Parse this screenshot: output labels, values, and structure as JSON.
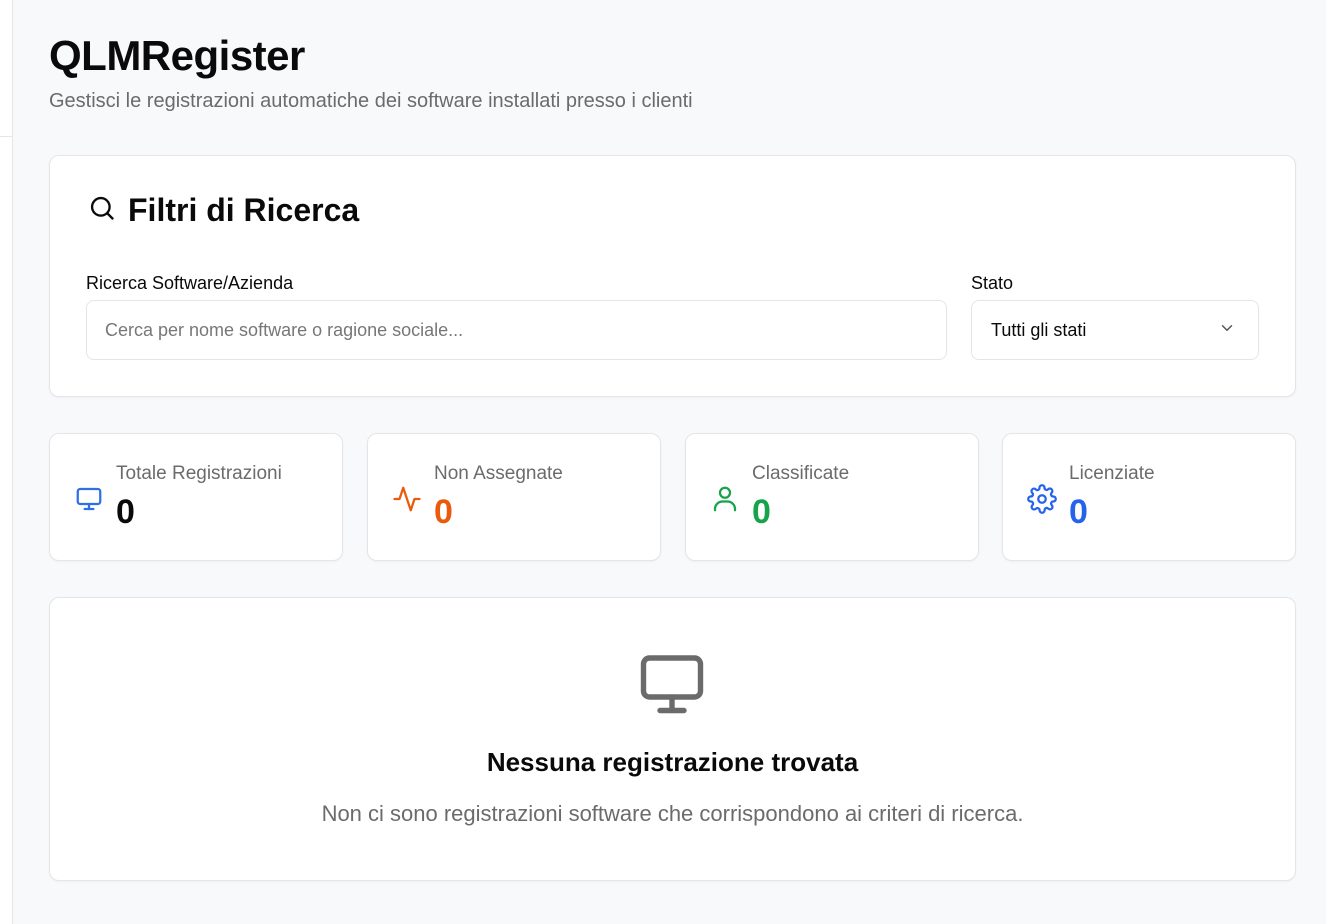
{
  "header": {
    "title": "QLMRegister",
    "subtitle": "Gestisci le registrazioni automatiche dei software installati presso i clienti"
  },
  "filters": {
    "title": "Filtri di Ricerca",
    "search": {
      "label": "Ricerca Software/Azienda",
      "placeholder": "Cerca per nome software o ragione sociale...",
      "value": ""
    },
    "status": {
      "label": "Stato",
      "selected": "Tutti gli stati"
    }
  },
  "stats": [
    {
      "label": "Totale Registrazioni",
      "value": "0",
      "icon": "monitor-icon",
      "color": "#2f6fe8",
      "value_color": "#0a0a0a"
    },
    {
      "label": "Non Assegnate",
      "value": "0",
      "icon": "activity-icon",
      "color": "#ea5a0c",
      "value_color": "#ea5a0c"
    },
    {
      "label": "Classificate",
      "value": "0",
      "icon": "user-icon",
      "color": "#16a34a",
      "value_color": "#16a34a"
    },
    {
      "label": "Licenziate",
      "value": "0",
      "icon": "settings-icon",
      "color": "#2563eb",
      "value_color": "#2563eb"
    }
  ],
  "empty_state": {
    "icon": "monitor-icon",
    "title": "Nessuna registrazione trovata",
    "description": "Non ci sono registrazioni software che corrispondono ai criteri di ricerca."
  }
}
